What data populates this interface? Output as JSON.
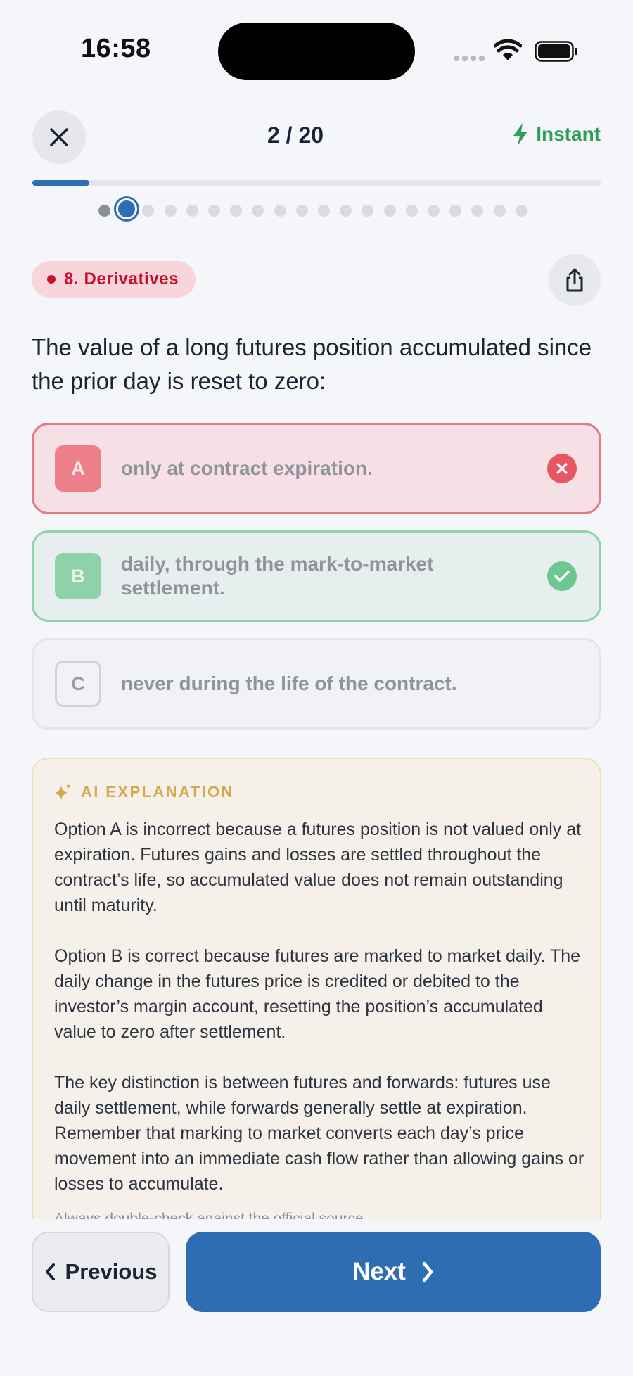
{
  "status_bar": {
    "time": "16:58"
  },
  "header": {
    "counter": "2 / 20",
    "mode_label": "Instant"
  },
  "progress": {
    "current": 2,
    "total": 20,
    "fraction": 0.1
  },
  "topic": {
    "label": "8. Derivatives",
    "color": "#c8102e"
  },
  "question": {
    "text": "The value of a long futures position accumulated since the prior day is reset to zero:"
  },
  "options": [
    {
      "letter": "A",
      "text": "only at contract expiration.",
      "state": "incorrect"
    },
    {
      "letter": "B",
      "text": "daily, through the mark-to-market settlement.",
      "state": "correct"
    },
    {
      "letter": "C",
      "text": "never during the life of the contract.",
      "state": "neutral"
    }
  ],
  "explanation": {
    "title": "AI EXPLANATION",
    "paragraphs": [
      "Option A is incorrect because a futures position is not valued only at expiration. Futures gains and losses are settled throughout the contract’s life, so accumulated value does not remain outstanding until maturity.",
      "Option B is correct because futures are marked to market daily. The daily change in the futures price is credited or debited to the investor’s margin account, resetting the position’s accumulated value to zero after settlement.",
      "The key distinction is between futures and forwards: futures use daily settlement, while forwards generally settle at expiration. Remember that marking to market converts each day’s price movement into an immediate cash flow rather than allowing gains or losses to accumulate."
    ],
    "disclaimer": "Always double-check against the official source."
  },
  "navigation": {
    "previous_label": "Previous",
    "next_label": "Next"
  },
  "colors": {
    "accent": "#2f6db3",
    "instant": "#2f9e5a",
    "incorrect": "#e45763",
    "correct": "#6dc790",
    "explanation_title": "#d4a94a"
  }
}
